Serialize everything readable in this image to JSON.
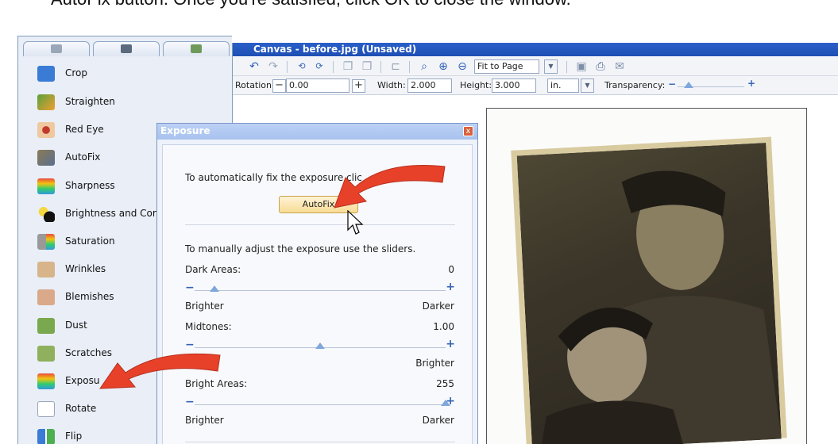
{
  "caption": "AutoFix button. Once you're satisfied, click OK to close the window.",
  "tools_panel": {
    "tabs": [
      {
        "icon": "tools-icon"
      },
      {
        "icon": "toolbox-icon"
      },
      {
        "icon": "image-icon"
      }
    ],
    "items": [
      {
        "label": "Crop",
        "icon": "crop-icon"
      },
      {
        "label": "Straighten",
        "icon": "straighten-icon"
      },
      {
        "label": "Red Eye",
        "icon": "red-eye-icon"
      },
      {
        "label": "AutoFix",
        "icon": "autofix-icon"
      },
      {
        "label": "Sharpness",
        "icon": "sharpness-icon"
      },
      {
        "label": "Brightness and Cor",
        "icon": "brightness-icon"
      },
      {
        "label": "Saturation",
        "icon": "saturation-icon"
      },
      {
        "label": "Wrinkles",
        "icon": "wrinkles-icon"
      },
      {
        "label": "Blemishes",
        "icon": "blemishes-icon"
      },
      {
        "label": "Dust",
        "icon": "dust-icon"
      },
      {
        "label": "Scratches",
        "icon": "scratches-icon"
      },
      {
        "label": "Exposu",
        "icon": "exposure-icon"
      },
      {
        "label": "Rotate",
        "icon": "rotate-icon"
      },
      {
        "label": "Flip",
        "icon": "flip-icon"
      }
    ]
  },
  "canvas": {
    "title": "Canvas - before.jpg (Unsaved)",
    "toolbar": {
      "zoom_select": "Fit to Page"
    },
    "properties": {
      "rotation_label": "Rotation:",
      "rotation_value": "0.00",
      "width_label": "Width:",
      "width_value": "2.000",
      "height_label": "Height:",
      "height_value": "3.000",
      "unit": "in.",
      "transparency_label": "Transparency:"
    }
  },
  "exposure_dialog": {
    "title": "Exposure",
    "close_label": "x",
    "auto_text": "To automatically fix the exposure clic",
    "autofix_label": "AutoFix",
    "manual_text": "To manually adjust the exposure use the sliders.",
    "dark": {
      "label": "Dark Areas:",
      "value": "0",
      "left": "Brighter",
      "right": "Darker",
      "level": 0.08
    },
    "mid": {
      "label": "Midtones:",
      "value": "1.00",
      "left": "er",
      "right": "Brighter",
      "level": 0.5
    },
    "bright": {
      "label": "Bright Areas:",
      "value": "255",
      "left": "Brighter",
      "right": "Darker",
      "level": 1.0
    }
  },
  "colors": {
    "titlebar": "#1e4fb3",
    "arrow": "#e8412a",
    "accent": "#3463b5"
  }
}
